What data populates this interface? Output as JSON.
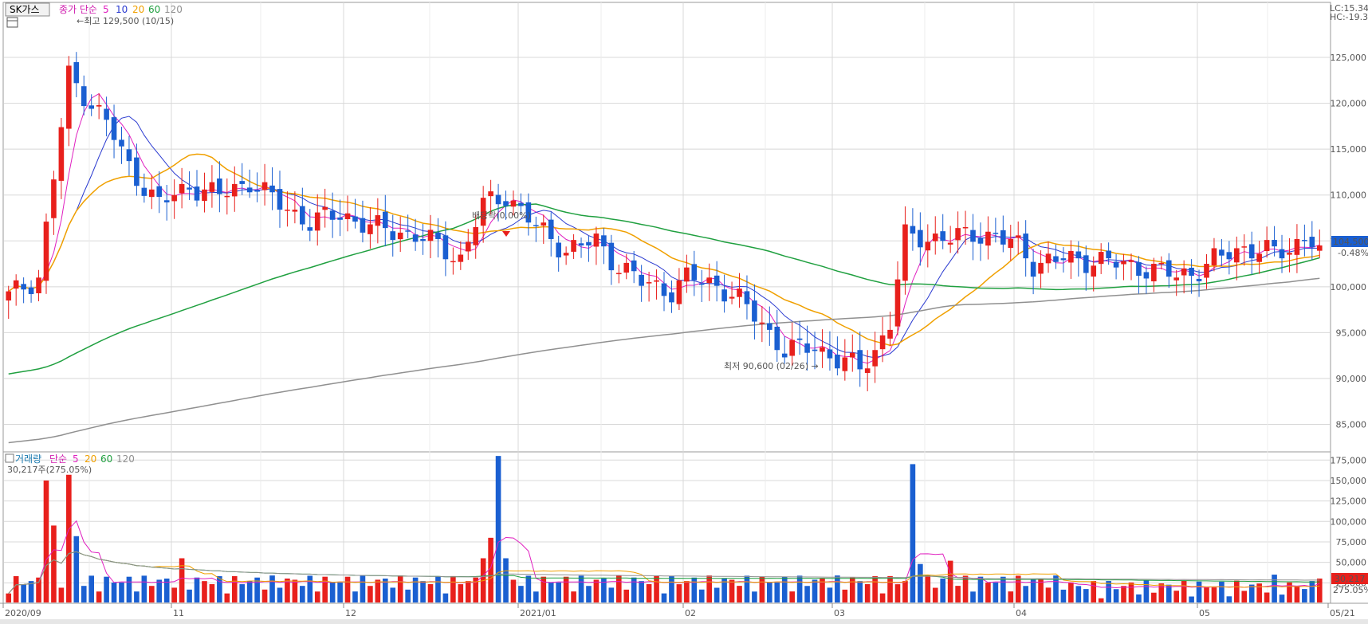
{
  "window": {
    "stock_name": "SK가스",
    "lc_label": "LC:15.34",
    "hc_label": "HC:-19.3",
    "legend_price_label": "종가 단순",
    "legend_volume_label": "거래량",
    "legend_volume_ma_label": "단순",
    "ma_periods": [
      "5",
      "10",
      "20",
      "60",
      "120"
    ],
    "volume_info": "30,217주(275.05%)"
  },
  "annotations": {
    "high": "←최고 129,500 (10/15)",
    "low": "최저 90,600 (02/26) →",
    "dividend": "배당락(0.00%)",
    "current_price": "104,500",
    "current_change": "-0.48%",
    "current_volume": "30,217",
    "current_volume_pct": "275.05%"
  },
  "colors": {
    "up": "#e8201c",
    "down": "#1a5fd1",
    "ma5": "#e020c0",
    "ma10": "#2a3ad0",
    "ma20": "#f0a000",
    "ma60": "#20a040",
    "ma120": "#909090",
    "grid": "#d8d8d8"
  },
  "chart_data": [
    {
      "type": "candlestick",
      "title": "SK가스",
      "y_ticks": [
        "125,000",
        "120,000",
        "115,000",
        "110,000",
        "105,000",
        "100,000",
        "95,000",
        "90,000",
        "85,000"
      ],
      "ylim": [
        82000,
        131000
      ],
      "x_labels": [
        "2020/09",
        "11",
        "12",
        "2021/01",
        "02",
        "03",
        "04",
        "05",
        "05/21"
      ],
      "grid": true,
      "high_point": {
        "value": 129500,
        "date": "10/15"
      },
      "low_point": {
        "value": 90600,
        "date": "02/26"
      },
      "last_close": 104500,
      "last_change_pct": -0.48,
      "ma_periods": [
        5,
        10,
        20,
        60,
        120
      ]
    },
    {
      "type": "bar",
      "title": "거래량",
      "y_ticks": [
        "175,000",
        "150,000",
        "125,000",
        "100,000",
        "75,000",
        "50,000",
        "25,000"
      ],
      "ylim": [
        0,
        185000
      ],
      "last_volume": 30217,
      "last_volume_pct": 275.05,
      "ma_periods": [
        5,
        20,
        60,
        120
      ]
    }
  ]
}
